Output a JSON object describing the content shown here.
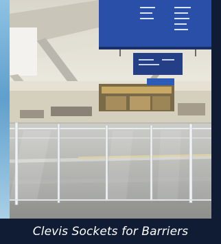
{
  "caption": {
    "text": "Clevis Sockets for Barriers"
  },
  "image": {
    "icon": "airport-terminal-barrier-photo"
  },
  "colors": {
    "caption_background": "#0f1c33",
    "caption_text": "#ffffff",
    "sign_blue": "#2a4fa8"
  }
}
